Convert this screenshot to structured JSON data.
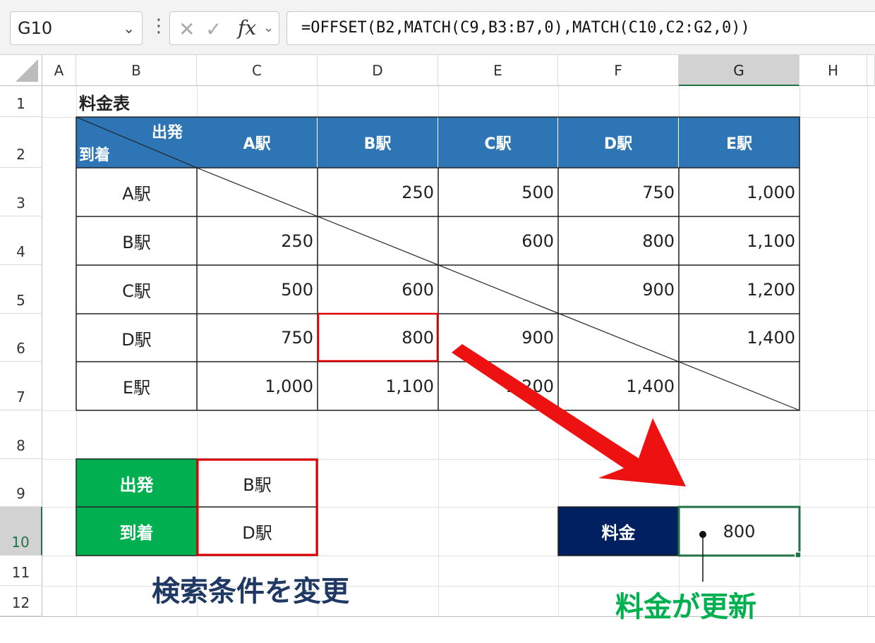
{
  "formula_bar": {
    "name_box": "G10",
    "name_box_arrow": "⌄",
    "dots": "⋮",
    "cancel": "✕",
    "enter": "✓",
    "fx": "fx",
    "fx_arrow": "⌄",
    "formula": "=OFFSET(B2,MATCH(C9,B3:B7,0),MATCH(C10,C2:G2,0))"
  },
  "columns": [
    "A",
    "B",
    "C",
    "D",
    "E",
    "F",
    "G",
    "H"
  ],
  "rows": [
    "1",
    "2",
    "3",
    "4",
    "5",
    "6",
    "7",
    "8",
    "9",
    "10",
    "11",
    "12"
  ],
  "selected": {
    "column": "G",
    "row": "10"
  },
  "sheet": {
    "title": "料金表",
    "corner_top": "出発",
    "corner_bottom": "到着",
    "header_stations": [
      "A駅",
      "B駅",
      "C駅",
      "D駅",
      "E駅"
    ],
    "row_stations": [
      "A駅",
      "B駅",
      "C駅",
      "D駅",
      "E駅"
    ],
    "fares": [
      [
        "",
        "250",
        "500",
        "750",
        "1,000"
      ],
      [
        "250",
        "",
        "600",
        "800",
        "1,100"
      ],
      [
        "500",
        "600",
        "",
        "900",
        "1,200"
      ],
      [
        "750",
        "800",
        "900",
        "",
        "1,400"
      ],
      [
        "1,000",
        "1,100",
        "1,200",
        "1,400",
        ""
      ]
    ],
    "depart_label": "出発",
    "depart_value": "B駅",
    "arrive_label": "到着",
    "arrive_value": "D駅",
    "fare_label": "料金",
    "fare_value": "800"
  },
  "annotations": {
    "left": "検索条件を変更",
    "right": "料金が更新"
  },
  "colors": {
    "header_blue": "#2e75b6",
    "label_green": "#00b050",
    "label_navy": "#002060",
    "highlight_red": "#e00000",
    "annot_blue": "#1f3864",
    "annot_green": "#00b050",
    "excel_green": "#217346"
  }
}
